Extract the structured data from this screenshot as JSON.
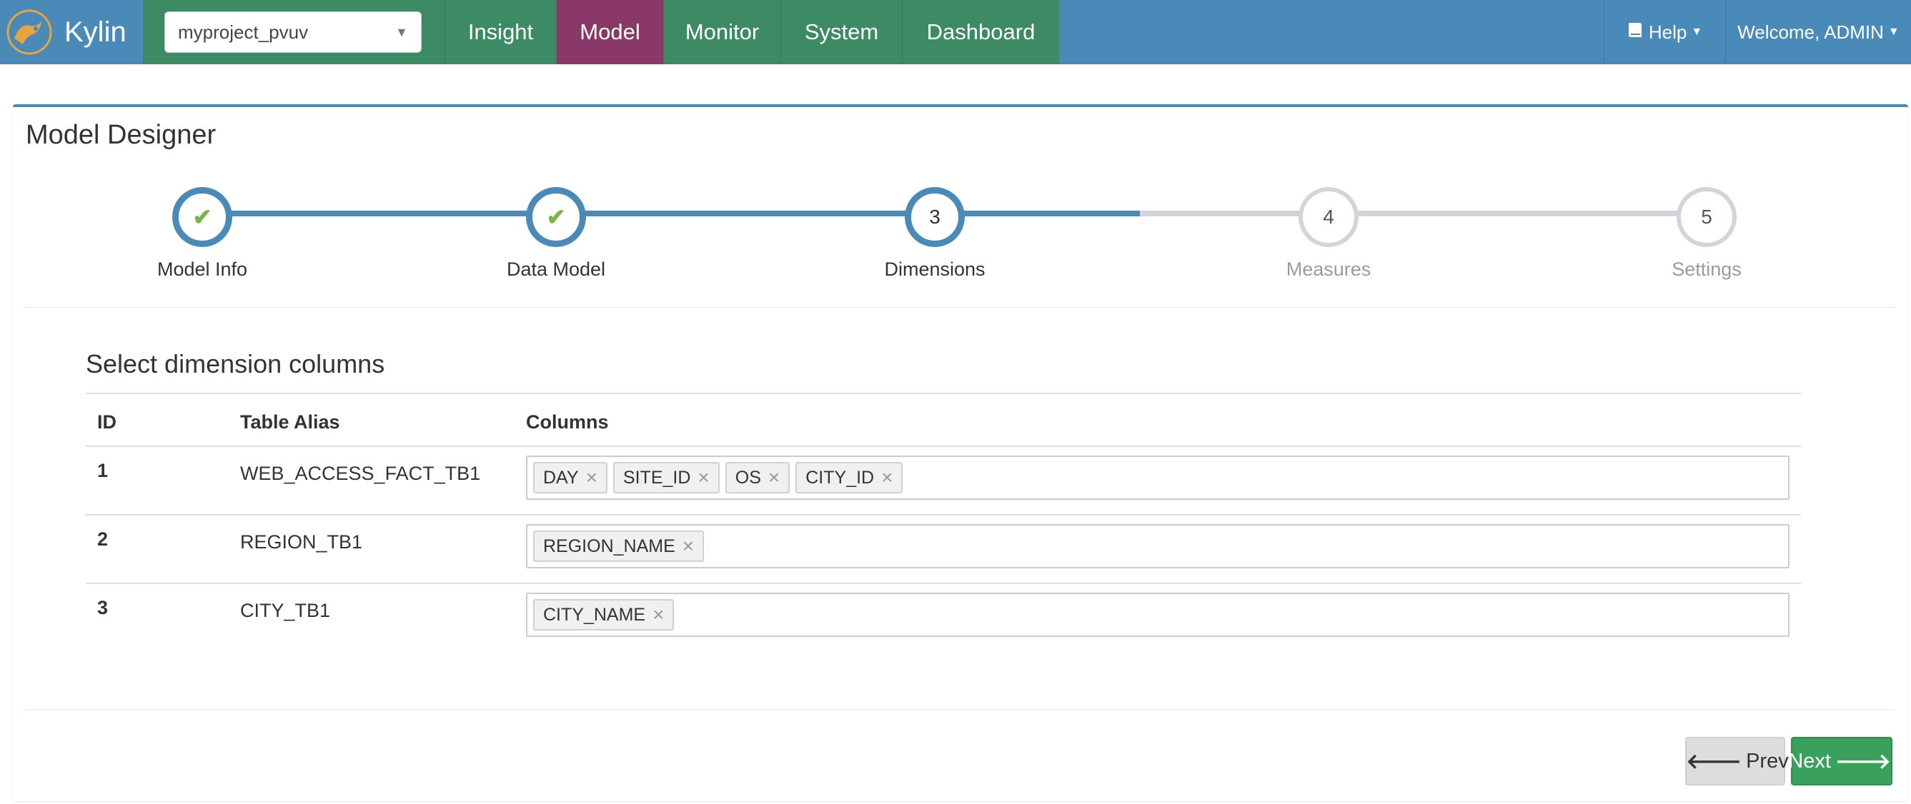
{
  "navbar": {
    "brand": "Kylin",
    "project": "myproject_pvuv",
    "items": [
      "Insight",
      "Model",
      "Monitor",
      "System",
      "Dashboard"
    ],
    "active_item": "Model",
    "help": "Help",
    "user": "Welcome, ADMIN",
    "colors": {
      "navbar": "#4a8ab9",
      "nav_item": "#3d8b65",
      "nav_active": "#8a3868"
    }
  },
  "panel": {
    "title": "Model Designer"
  },
  "wizard": {
    "steps": [
      {
        "number": "1",
        "label": "Model Info",
        "state": "done"
      },
      {
        "number": "2",
        "label": "Data Model",
        "state": "done"
      },
      {
        "number": "3",
        "label": "Dimensions",
        "state": "current"
      },
      {
        "number": "4",
        "label": "Measures",
        "state": "todo"
      },
      {
        "number": "5",
        "label": "Settings",
        "state": "todo"
      }
    ]
  },
  "dimensions": {
    "title": "Select dimension columns",
    "headers": {
      "id": "ID",
      "alias": "Table Alias",
      "columns": "Columns"
    },
    "rows": [
      {
        "id": "1",
        "alias": "WEB_ACCESS_FACT_TB1",
        "columns": [
          "DAY",
          "SITE_ID",
          "OS",
          "CITY_ID"
        ]
      },
      {
        "id": "2",
        "alias": "REGION_TB1",
        "columns": [
          "REGION_NAME"
        ]
      },
      {
        "id": "3",
        "alias": "CITY_TB1",
        "columns": [
          "CITY_NAME"
        ]
      }
    ]
  },
  "footer": {
    "prev": "Prev",
    "next": "Next"
  }
}
